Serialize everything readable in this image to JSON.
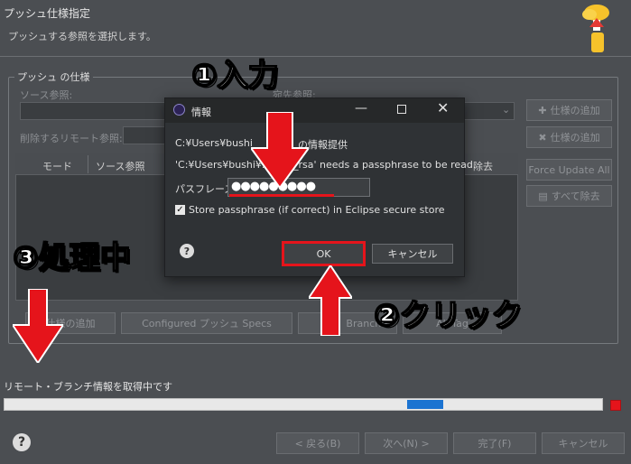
{
  "wizard": {
    "title": "プッシュ仕様指定",
    "subtitle": "プッシュする参照を選択します。",
    "group_title": "プッシュ の仕様",
    "source_ref_label": "ソース参照:",
    "dest_ref_label": "宛先参照:",
    "delete_remote_label": "削除するリモート参照:",
    "add_spec_label": "仕様の追加",
    "table_headers": [
      "モード",
      "ソース参照",
      "除去"
    ],
    "force_update_all": "Force Update All",
    "remove_all": "すべて除去",
    "bottom_add_spec": "仕様の追加",
    "configured_push_specs": "Configured プッシュ Specs",
    "branches": "Branche",
    "all_tags": "All Tag",
    "progress_text": "リモート・ブランチ情報を取得中です",
    "progress_value": 0.05,
    "back": "< 戻る(B)",
    "next": "次へ(N) >",
    "finish": "完了(F)",
    "cancel": "キャンセル"
  },
  "dialog": {
    "title": "情報",
    "line1": "C:¥Users¥bushi",
    "line1b": "の情報提供",
    "line2a": "'C:¥Users¥bushi¥.s",
    "line2b": "d_rsa' needs a passphrase to be read.",
    "passphrase_label": "パスフレーズ",
    "passphrase_value": "●●●●●●●●●",
    "store_checkbox": "Store passphrase (if correct) in Eclipse secure store",
    "ok": "OK",
    "cancel": "キャンセル"
  },
  "annotations": {
    "step1": "①入力",
    "step2": "②クリック",
    "step3": "③処理中"
  },
  "colors": {
    "arrow_red": "#e5141b",
    "progress_blue": "#1b73d1"
  }
}
